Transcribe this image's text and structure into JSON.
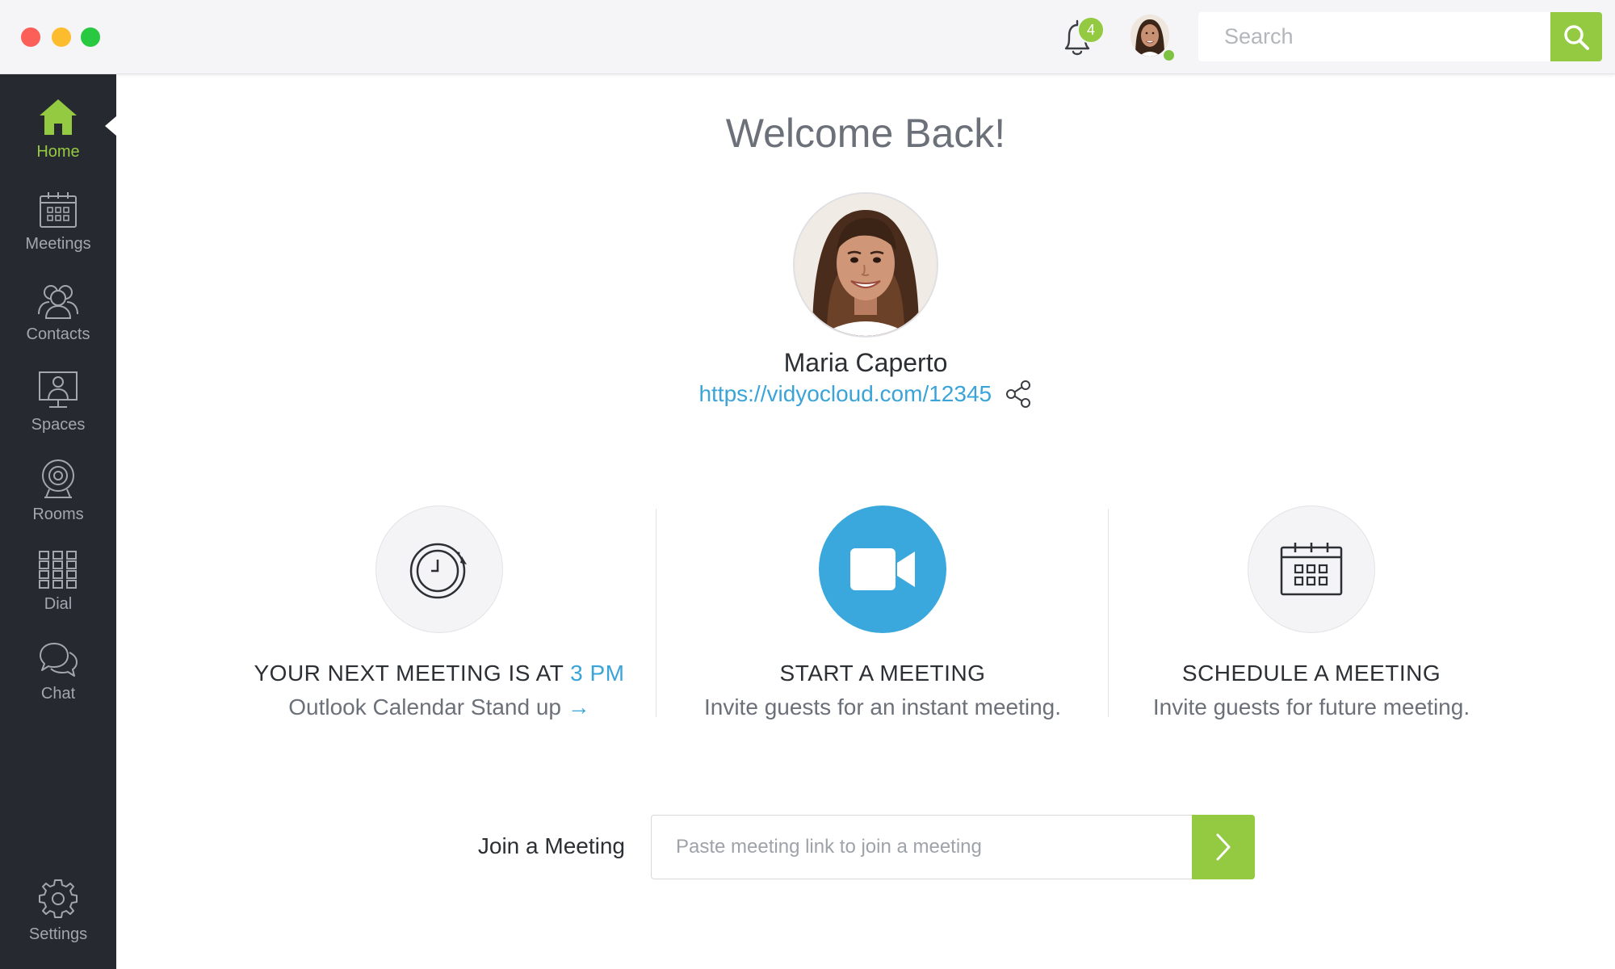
{
  "titlebar": {
    "notifications_count": "4",
    "search_placeholder": "Search"
  },
  "sidebar": {
    "items": [
      {
        "label": "Home",
        "icon": "home-icon",
        "active": true
      },
      {
        "label": "Meetings",
        "icon": "calendar-icon"
      },
      {
        "label": "Contacts",
        "icon": "contacts-icon"
      },
      {
        "label": "Spaces",
        "icon": "spaces-icon"
      },
      {
        "label": "Rooms",
        "icon": "webcam-icon"
      },
      {
        "label": "Dial",
        "icon": "dialpad-icon"
      },
      {
        "label": "Chat",
        "icon": "chat-icon"
      }
    ],
    "settings_label": "Settings"
  },
  "main": {
    "welcome": "Welcome Back!",
    "profile": {
      "name": "Maria Caperto",
      "link": "https://vidyocloud.com/12345"
    },
    "cards": [
      {
        "title": "YOUR NEXT MEETING IS AT ",
        "title_accent": "3 PM",
        "subtitle": "Outlook Calendar Stand up",
        "arrow": "→"
      },
      {
        "title": "START A MEETING",
        "subtitle": "Invite guests for an instant meeting."
      },
      {
        "title": "SCHEDULE A MEETING",
        "subtitle": "Invite guests for future meeting."
      }
    ],
    "join": {
      "label": "Join a Meeting",
      "placeholder": "Paste meeting link to join a meeting"
    }
  },
  "colors": {
    "accent_green": "#94c942",
    "accent_blue": "#3aa4d8",
    "sidebar_bg": "#26292f"
  }
}
